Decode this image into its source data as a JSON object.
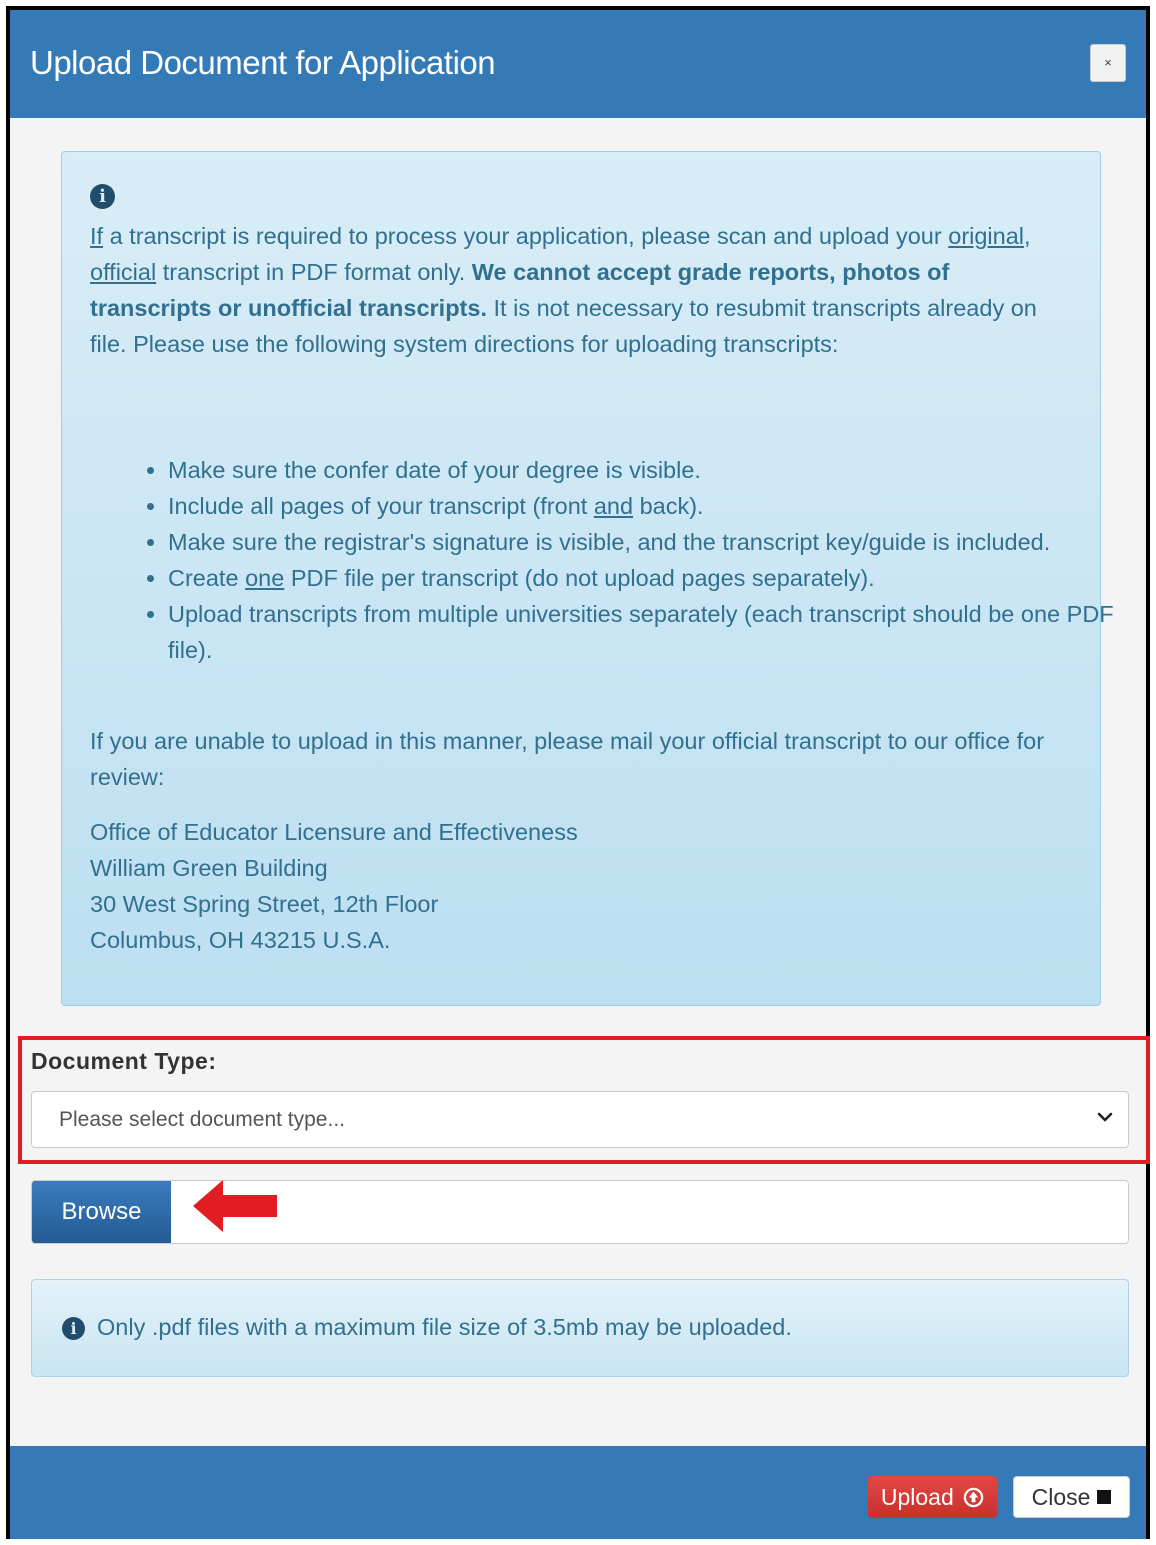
{
  "modal": {
    "title": "Upload Document for Application",
    "close_x": "×"
  },
  "info": {
    "icon": "info-circle-icon",
    "para1": {
      "if": "If",
      "t1": " a transcript is required to process your application, please scan and upload your ",
      "original": "original",
      "comma": ", ",
      "official": "official",
      "t2": " transcript in PDF format only. ",
      "bold": "We cannot accept grade reports, photos of transcripts or unofficial transcripts.",
      "t3": " It is not necessary to resubmit transcripts already on file. Please use the following system directions for uploading transcripts:"
    },
    "bullets": {
      "b1": "Make sure the confer date of your degree is visible.",
      "b2_pre": "Include all pages of your transcript (front ",
      "b2_and": "and",
      "b2_post": " back).",
      "b3": "Make sure the registrar's signature is visible, and the transcript key/guide is included.",
      "b4_pre": "Create ",
      "b4_one": "one",
      "b4_post": " PDF file per transcript (do not upload pages separately).",
      "b5": "Upload transcripts from multiple universities separately (each transcript should be one PDF file)."
    },
    "para2": "If you are unable to upload in this manner, please mail your official transcript to our office for review:",
    "address": [
      "Office of Educator Licensure and Effectiveness",
      "William Green Building",
      "30 West Spring Street, 12th Floor",
      "Columbus, OH 43215 U.S.A."
    ]
  },
  "document_type": {
    "label": "Document Type:",
    "selected": "Please select document type..."
  },
  "browse": {
    "label": "Browse",
    "file_value": ""
  },
  "notice": {
    "icon": "info-circle-icon",
    "text": "Only .pdf files with a maximum file size of 3.5mb may be uploaded."
  },
  "footer": {
    "upload_label": "Upload",
    "close_label": "Close"
  },
  "colors": {
    "header": "#337ab7",
    "info_text": "#31708f",
    "highlight": "#e31b23",
    "upload_btn": "#d9534f"
  }
}
